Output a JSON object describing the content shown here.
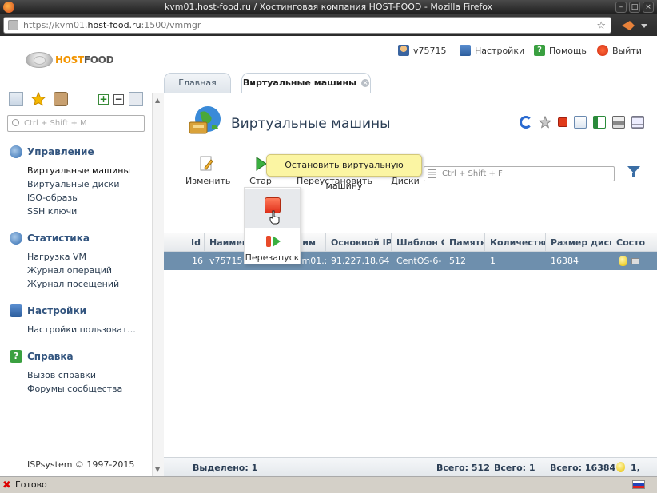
{
  "browser": {
    "title": "kvm01.host-food.ru / Хостинговая компания HOST-FOOD - Mozilla Firefox",
    "url_prefix": "https://kvm01.",
    "url_host": "host-food.ru",
    "url_suffix": ":1500/vmmgr",
    "status": "Готово"
  },
  "header": {
    "logo_prefix": "HOST",
    "logo_suffix": "FOOD",
    "user": "v75715",
    "settings": "Настройки",
    "help": "Помощь",
    "logout": "Выйти"
  },
  "tabs": [
    {
      "label": "Главная",
      "active": false
    },
    {
      "label": "Виртуальные машины",
      "active": true
    }
  ],
  "sidebar": {
    "search_placeholder": "Ctrl + Shift + M",
    "sections": [
      {
        "title": "Управление",
        "items": [
          "Виртуальные машины",
          "Виртуальные диски",
          "ISO-образы",
          "SSH ключи"
        ]
      },
      {
        "title": "Статистика",
        "items": [
          "Нагрузка VM",
          "Журнал операций",
          "Журнал посещений"
        ]
      },
      {
        "title": "Настройки",
        "items": [
          "Настройки пользоват..."
        ]
      },
      {
        "title": "Справка",
        "items": [
          "Вызов справки",
          "Форумы сообщества"
        ]
      }
    ],
    "copyright": "ISPsystem © 1997-2015"
  },
  "main": {
    "title": "Виртуальные машины",
    "toolbar": {
      "edit": "Изменить",
      "start": "Стар",
      "reinstall": "Переустановить",
      "disks": "Диски",
      "search_placeholder": "Ctrl + Shift + F"
    },
    "tooltip": "Остановить виртуальную машину",
    "popup": {
      "restart": "Перезапуск"
    },
    "columns": [
      "Id",
      "Наимен",
      "е им",
      "Основной IP",
      "Шаблон С",
      "Память",
      "Количество",
      "Размер диск",
      "Состо"
    ],
    "rows": [
      {
        "id": "16",
        "name": "v75715",
        "host": "vm01.:",
        "ip": "91.227.18.64",
        "template": "CentOS-6-",
        "memory": "512",
        "count": "1",
        "disk": "16384"
      }
    ],
    "footer": {
      "selected": "Выделено: 1",
      "total_memory": "Всего: 512",
      "total_count": "Всего: 1",
      "total_disk": "Всего: 16384",
      "status_total": "1,"
    }
  },
  "colors": {
    "accent": "#33557f",
    "selected_row": "#6e8fad",
    "tooltip_bg": "#fbf5a3",
    "logo_orange": "#f29400"
  }
}
